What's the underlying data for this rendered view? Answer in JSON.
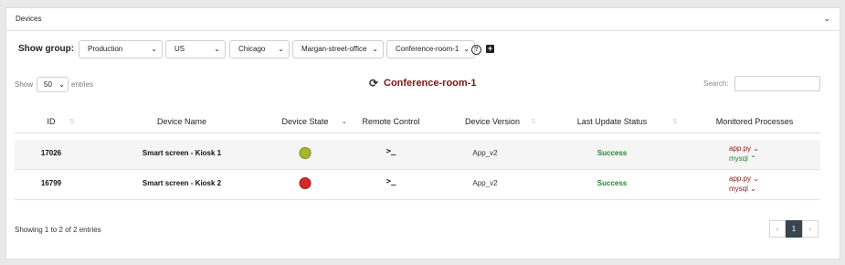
{
  "panel": {
    "title": "Devices",
    "toggle_icon": "chevron-down-icon"
  },
  "group": {
    "label": "Show group:",
    "selects": [
      "Production",
      "US",
      "Chicago",
      "Margan-street-office",
      "Conference-room-1"
    ]
  },
  "length": {
    "show_label": "Show",
    "value": "50",
    "entries_label": "entries"
  },
  "heading": {
    "title": "Conference-room-1"
  },
  "search": {
    "label": "Search:",
    "value": ""
  },
  "table": {
    "headers": {
      "id": "ID",
      "name": "Device Name",
      "state": "Device State",
      "remote": "Remote Control",
      "version": "Device Version",
      "update": "Last Update Status",
      "processes": "Monitored Processes"
    },
    "rows": [
      {
        "id": "17026",
        "name": "Smart screen - Kiosk 1",
        "state_color": "#a9b52b",
        "remote": ">_",
        "version": "App_v2",
        "update": "Success",
        "processes": [
          {
            "name": "app.py",
            "chevron": "⌄",
            "color": "#8b1a1a"
          },
          {
            "name": "mysql",
            "chevron": "⌃",
            "color": "#1e8a2e"
          }
        ]
      },
      {
        "id": "16799",
        "name": "Smart screen - Kiosk 2",
        "state_color": "#d42a2a",
        "remote": ">_",
        "version": "App_v2",
        "update": "Success",
        "processes": [
          {
            "name": "app.py",
            "chevron": "⌄",
            "color": "#8b1a1a"
          },
          {
            "name": "mysql",
            "chevron": "⌄",
            "color": "#8b1a1a"
          }
        ]
      }
    ]
  },
  "footer": {
    "info": "Showing 1 to 2 of 2 entries"
  },
  "pagination": {
    "prev": "‹",
    "page": "1",
    "next": "›"
  }
}
